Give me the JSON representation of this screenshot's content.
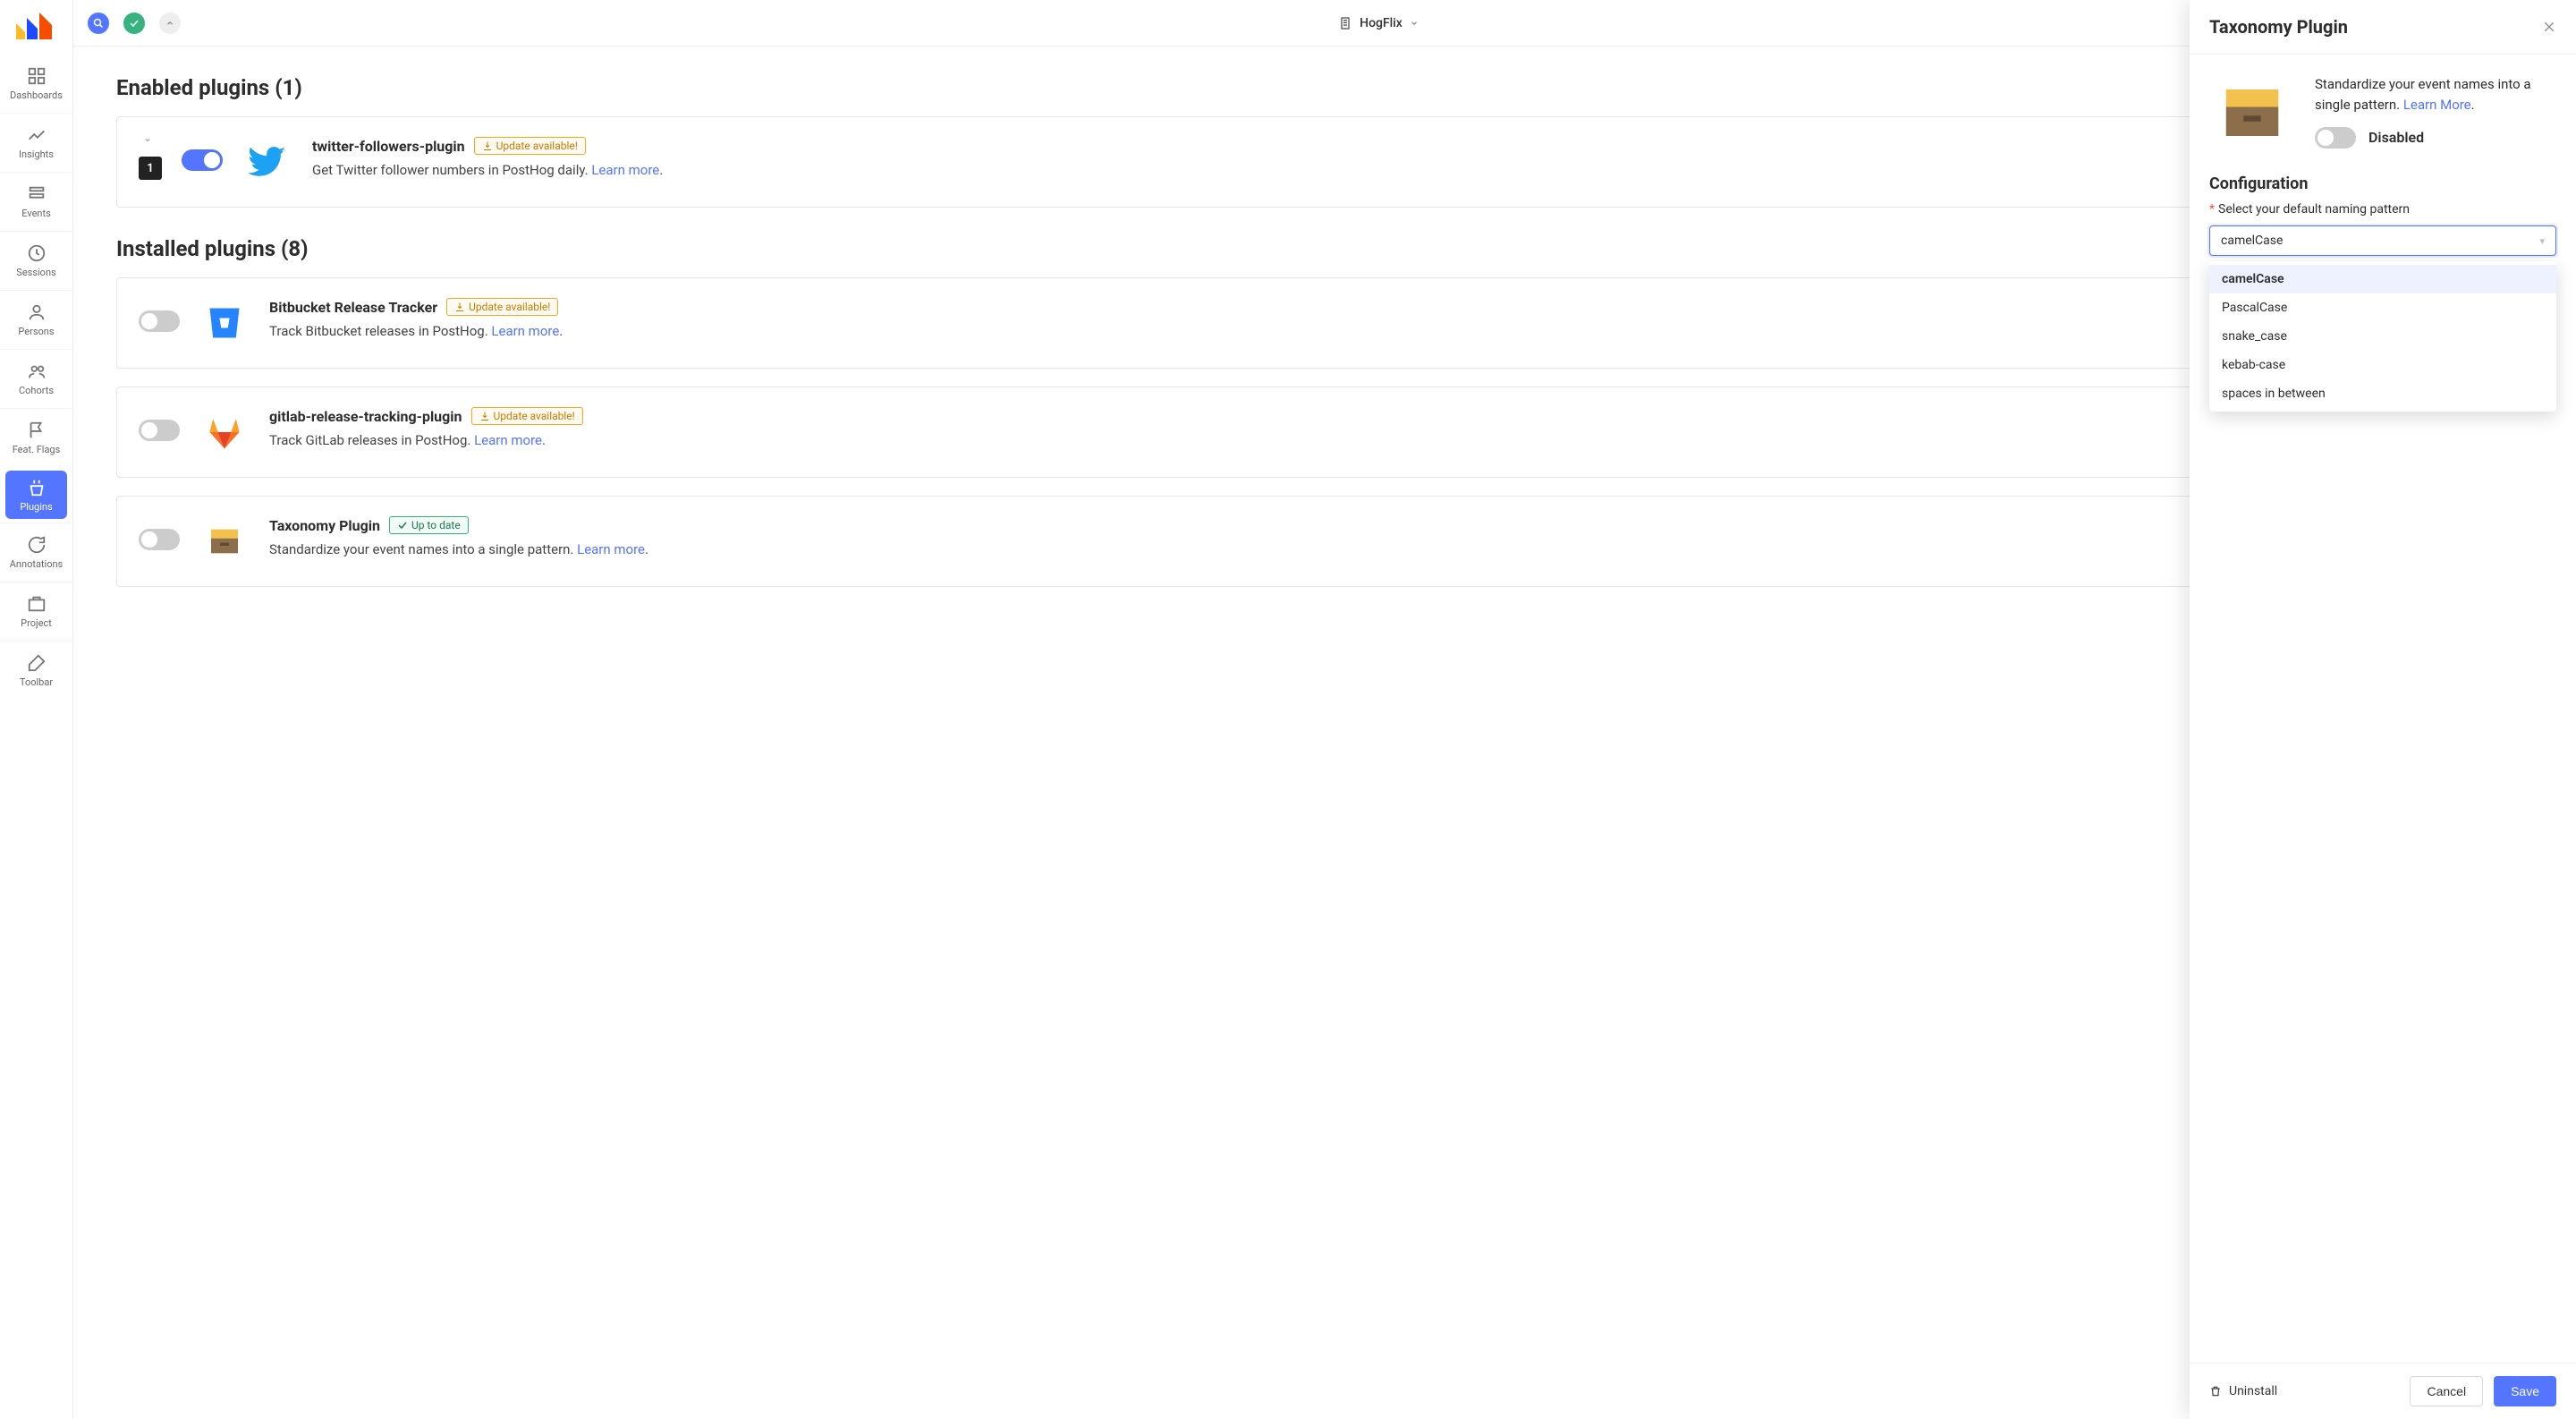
{
  "topbar": {
    "title": "HogFlix"
  },
  "nav": {
    "items": [
      {
        "label": "Dashboards"
      },
      {
        "label": "Insights"
      },
      {
        "label": "Events"
      },
      {
        "label": "Sessions"
      },
      {
        "label": "Persons"
      },
      {
        "label": "Cohorts"
      },
      {
        "label": "Feat. Flags"
      },
      {
        "label": "Plugins"
      },
      {
        "label": "Annotations"
      },
      {
        "label": "Project"
      },
      {
        "label": "Toolbar"
      }
    ]
  },
  "sections": {
    "enabled_heading": "Enabled plugins (1)",
    "installed_heading": "Installed plugins (8)"
  },
  "badges": {
    "update_available": "Update available!",
    "up_to_date": "Up to date"
  },
  "learn_more": "Learn more",
  "plugins": {
    "twitter": {
      "name": "twitter-followers-plugin",
      "order": "1",
      "desc_prefix": "Get Twitter follower numbers in PostHog daily. "
    },
    "bitbucket": {
      "name": "Bitbucket Release Tracker",
      "desc_prefix": "Track Bitbucket releases in PostHog. "
    },
    "gitlab": {
      "name": "gitlab-release-tracking-plugin",
      "desc_prefix": "Track GitLab releases in PostHog. "
    },
    "taxonomy": {
      "name": "Taxonomy Plugin",
      "desc_prefix": "Standardize your event names into a single pattern. "
    }
  },
  "panel": {
    "title": "Taxonomy Plugin",
    "summary": "Standardize your event names into a single pattern. ",
    "learn_more_label": "Learn More",
    "status": "Disabled",
    "config_heading": "Configuration",
    "field_label": "Select your default naming pattern",
    "required_mark": "*",
    "select_value": "camelCase",
    "options": [
      "camelCase",
      "PascalCase",
      "snake_case",
      "kebab-case",
      "spaces in between"
    ],
    "uninstall": "Uninstall",
    "cancel": "Cancel",
    "save": "Save"
  }
}
